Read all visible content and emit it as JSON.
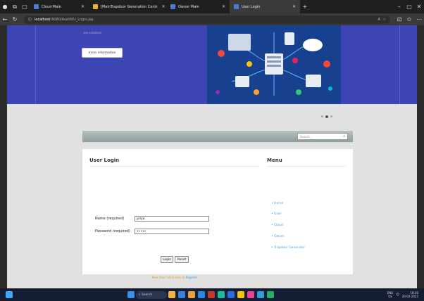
{
  "tabs": [
    {
      "title": "Cloud Main",
      "color": "#4a7bd4",
      "active": false
    },
    {
      "title": "[MainTrapdoor Generation Centr",
      "color": "#e7b630",
      "active": false
    },
    {
      "title": "Owner Main",
      "color": "#4a7bd4",
      "active": false
    },
    {
      "title": "User Login",
      "color": "#4a7bd4",
      "active": true
    }
  ],
  "address": {
    "host": "localhost",
    "path": ":8080/AuditVU_Login.jsp"
  },
  "hero": {
    "small_text": "see solutions",
    "more_button": "more information"
  },
  "search": {
    "placeholder": "Search..."
  },
  "login": {
    "title": "User Login",
    "name_label": "Name (required)",
    "name_value": "priya",
    "password_label": "Password (required)",
    "password_value": "•••••",
    "login_button": "Login",
    "reset_button": "Reset",
    "register_prefix": "New User? click here to",
    "register_link": "Register"
  },
  "menu": {
    "title": "Menu",
    "items": [
      "Home",
      "User",
      "Cloud",
      "Owner",
      "Trapdoor Generator"
    ]
  },
  "taskbar": {
    "search_placeholder": "Search",
    "lang": "ENG",
    "region": "US",
    "time": "18:30",
    "date": "20-02-2023"
  }
}
